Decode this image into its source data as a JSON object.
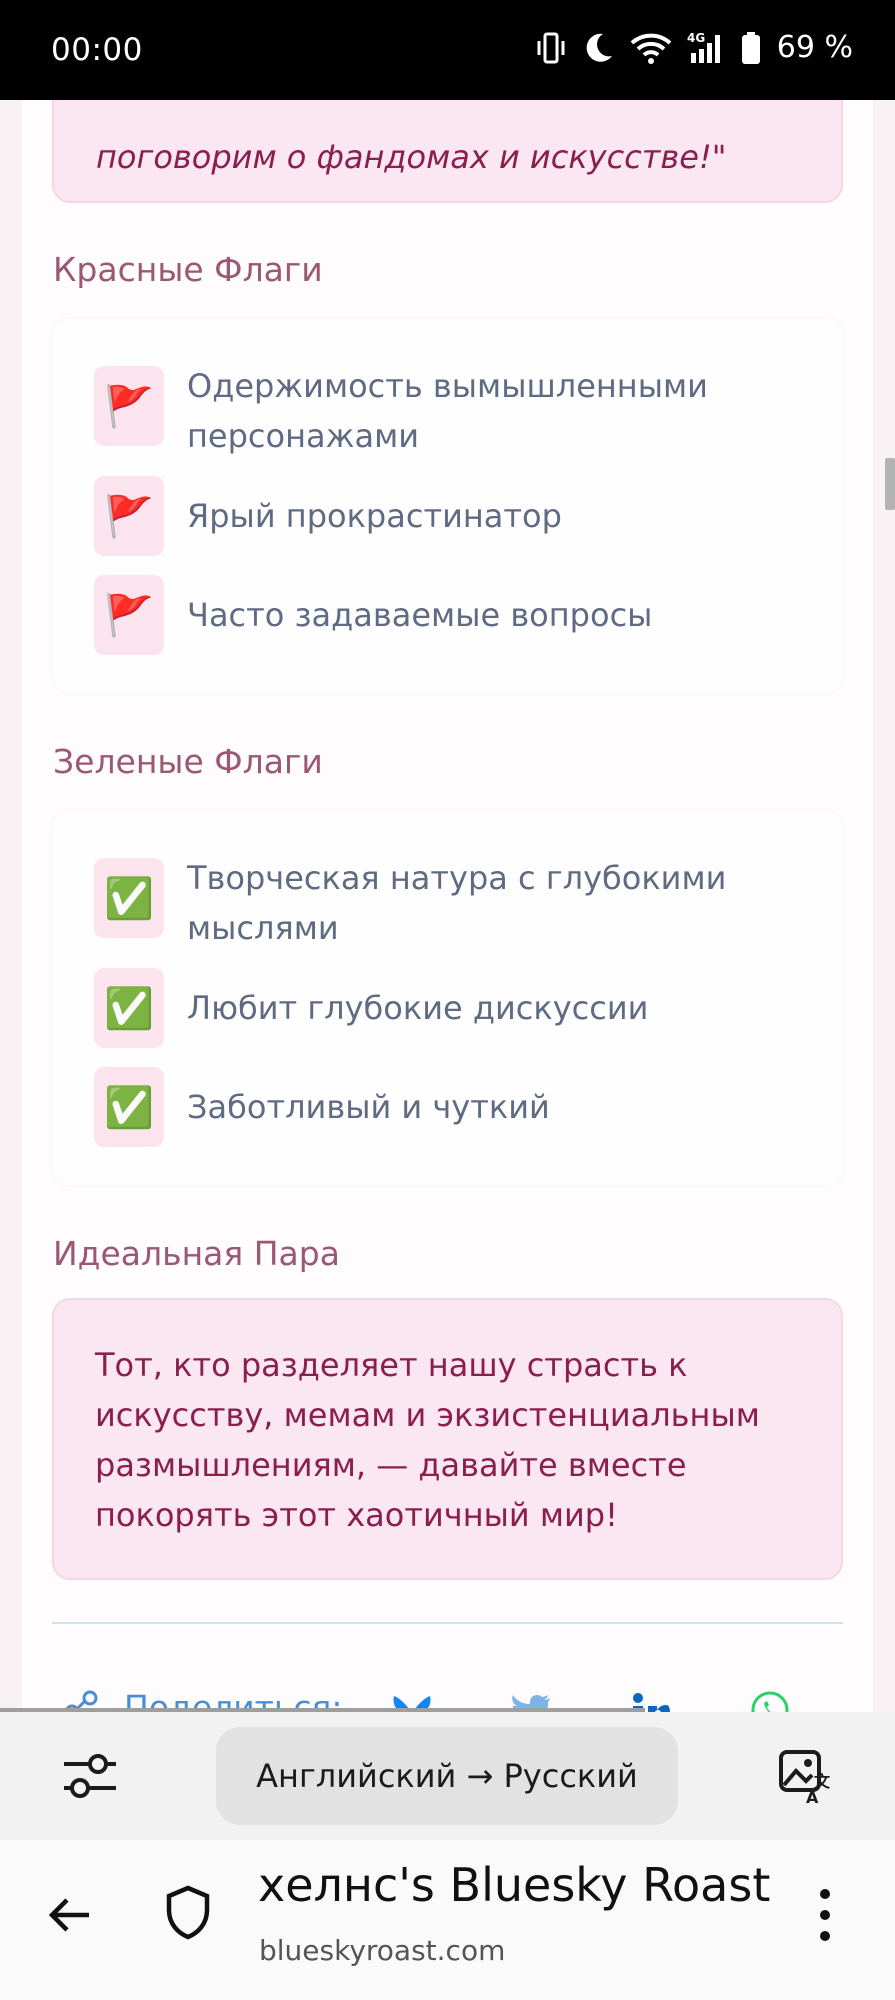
{
  "status_bar": {
    "time": "00:00",
    "battery": "69 %",
    "network": "4G",
    "icons": [
      "vibrate-icon",
      "moon-icon",
      "wifi-icon",
      "signal-icon",
      "battery-icon"
    ]
  },
  "quote": {
    "text": "поговорим о фандомах и искусстве!\""
  },
  "red_flags": {
    "title": "Красные Флаги",
    "icon": "🚩",
    "items": [
      {
        "text": "Одержимость вымышленными персонажами"
      },
      {
        "text": "Ярый прокрастинатор"
      },
      {
        "text": "Часто задаваемые вопросы"
      }
    ]
  },
  "green_flags": {
    "title": "Зеленые Флаги",
    "icon": "✅",
    "items": [
      {
        "text": "Творческая натура с глубокими мыслями"
      },
      {
        "text": "Любит глубокие дискуссии"
      },
      {
        "text": "Заботливый и чуткий"
      }
    ]
  },
  "ideal_match": {
    "title": "Идеальная Пара",
    "text": "Тот, кто разделяет нашу страсть к искусству, мемам и экзистенциальным размышлениям, — давайте вместе покорять этот хаотичный мир!"
  },
  "share": {
    "label": "Поделиться:",
    "icons": [
      "bluesky-icon",
      "twitter-icon",
      "linkedin-icon",
      "whatsapp-icon"
    ]
  },
  "translate_bar": {
    "language_label": "Английский → Русский"
  },
  "browser": {
    "page_title": "хелнс's Bluesky Roast",
    "url": "blueskyroast.com"
  },
  "colors": {
    "accent_text": "#8a1f4d",
    "section_title": "#9b5873",
    "card_pink": "#fbe7f1",
    "icon_bg": "#fce4ef",
    "item_text": "#5f6b82",
    "share_blue": "#4a8fd6"
  }
}
